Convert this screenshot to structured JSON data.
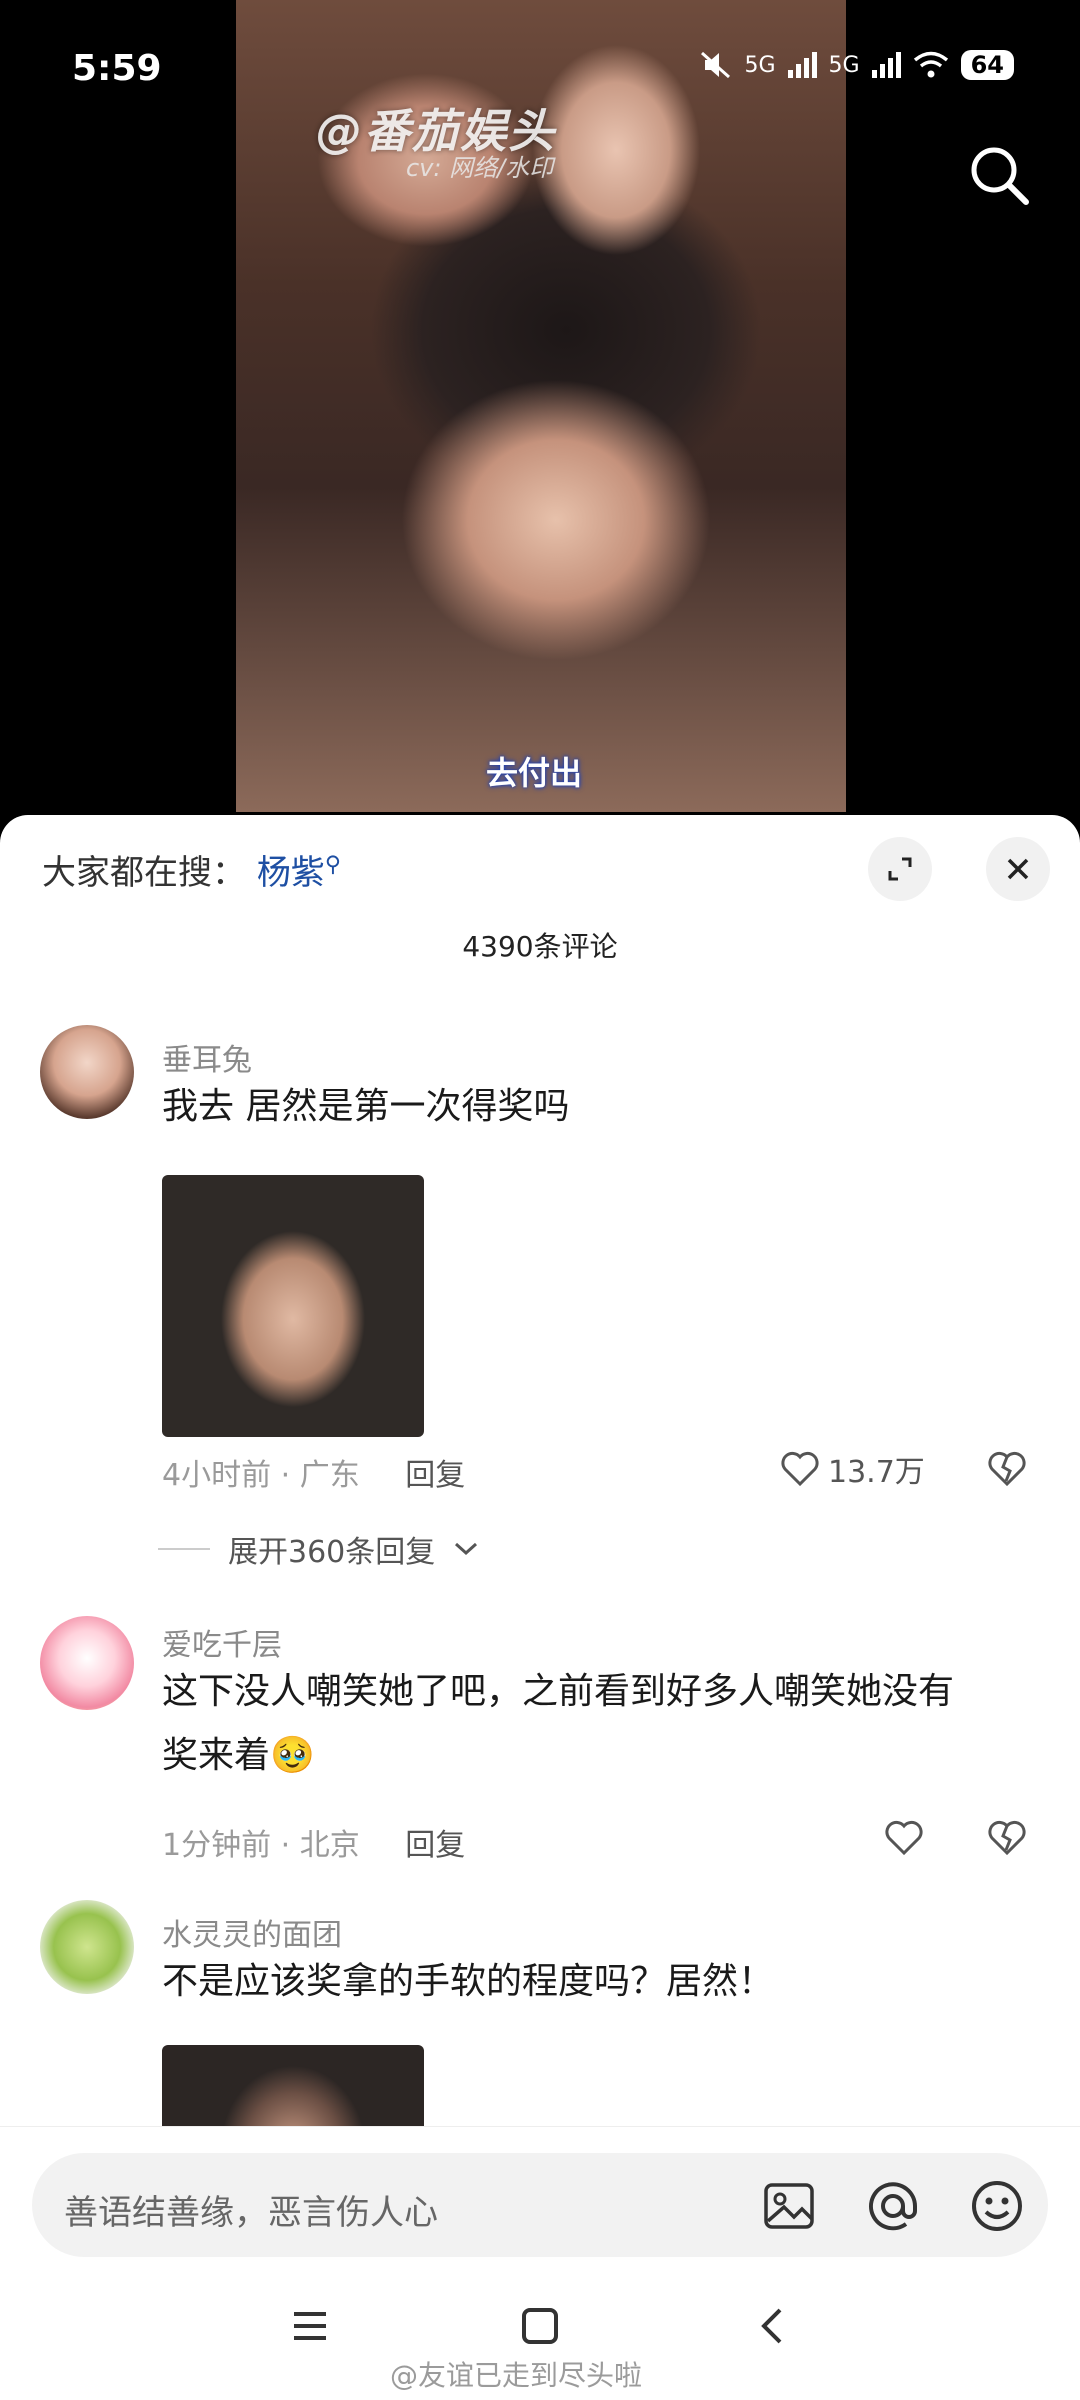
{
  "status_bar": {
    "time": "5:59",
    "net1": "5G",
    "net2": "5G",
    "battery": "64"
  },
  "video": {
    "watermark": "@番茄娱头",
    "watermark_sub": "cv: 网络/水印",
    "caption": "去付出"
  },
  "sheet": {
    "trend_prefix": "大家都在搜：",
    "trend_term": "杨紫",
    "count_label": "4390条评论"
  },
  "comments": [
    {
      "username": "垂耳兔",
      "text": "我去 居然是第一次得奖吗",
      "time": "4小时前",
      "location": "广东",
      "reply_label": "回复",
      "likes": "13.7万",
      "expand_label": "展开360条回复"
    },
    {
      "username": "爱吃千层",
      "text_line1": "这下没人嘲笑她了吧，之前看到好多人嘲笑她没有",
      "text_line2": "奖来着",
      "emoji": "🥹",
      "time": "1分钟前",
      "location": "北京",
      "reply_label": "回复"
    },
    {
      "username": "水灵灵的面团",
      "text": "不是应该奖拿的手软的程度吗？居然！"
    }
  ],
  "composer": {
    "placeholder": "善语结善缘，恶言伤人心"
  },
  "footer": {
    "credit": "@友谊已走到尽头啦"
  },
  "icons": {
    "search": "search-icon",
    "expand": "expand-icon",
    "close": "close-icon",
    "like": "heart-icon",
    "dislike": "broken-heart-icon",
    "image": "image-icon",
    "mention": "at-icon",
    "emoji": "smiley-icon"
  }
}
